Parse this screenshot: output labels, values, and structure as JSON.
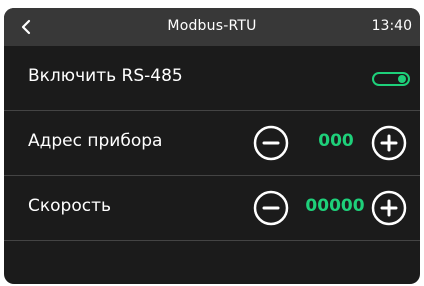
{
  "header": {
    "title": "Modbus-RTU",
    "time": "13:40"
  },
  "settings": {
    "rs485": {
      "label": "Включить RS-485",
      "enabled": true
    },
    "address": {
      "label": "Адрес прибора",
      "value": "000"
    },
    "speed": {
      "label": "Скорость",
      "value": "00000"
    }
  },
  "icons": {
    "back": "chevron-left-icon",
    "decrement": "minus-circle-icon",
    "increment": "plus-circle-icon"
  },
  "colors": {
    "accent": "#1ed07a",
    "header_bg": "#383838",
    "screen_bg": "#1b1b1b",
    "divider": "#444444",
    "text": "#ffffff"
  }
}
